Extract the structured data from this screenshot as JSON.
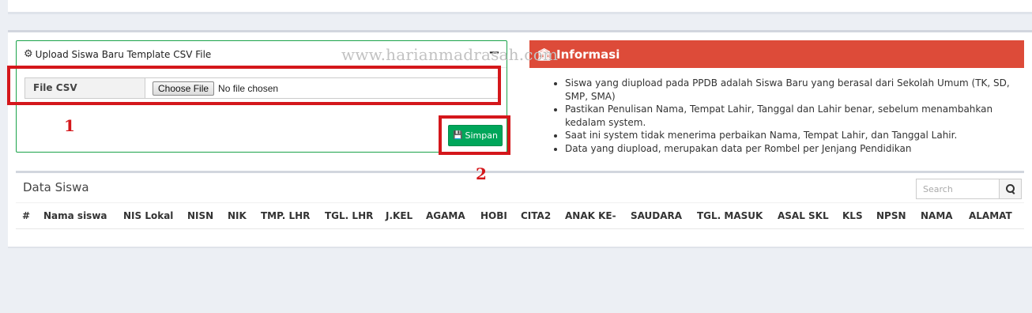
{
  "upload": {
    "title": "Upload Siswa Baru Template CSV File",
    "collapse_symbol": "−",
    "file_label": "File CSV",
    "choose_button": "Choose File",
    "file_status": "No file chosen",
    "save_button": "Simpan"
  },
  "watermark": "www.harianmadrasah.com",
  "annotations": {
    "box1_number": "1",
    "box2_number": "2"
  },
  "info": {
    "title": "Informasi",
    "items": [
      "Siswa yang diupload pada PPDB adalah Siswa Baru yang berasal dari Sekolah Umum (TK, SD, SMP, SMA)",
      "Pastikan Penulisan Nama, Tempat Lahir, Tanggal dan Lahir benar, sebelum menambahkan kedalam system.",
      "Saat ini system tidak menerima perbaikan Nama, Tempat Lahir, dan Tanggal Lahir.",
      "Data yang diupload, merupakan data per Rombel per Jenjang Pendidikan"
    ]
  },
  "data_siswa": {
    "title": "Data Siswa",
    "search_placeholder": "Search",
    "columns": [
      "#",
      "Nama siswa",
      "NIS Lokal",
      "NISN",
      "NIK",
      "TMP. LHR",
      "TGL. LHR",
      "J.KEL",
      "AGAMA",
      "HOBI",
      "CITA2",
      "ANAK KE-",
      "SAUDARA",
      "TGL. MASUK",
      "ASAL SKL",
      "KLS",
      "NPSN",
      "NAMA",
      "ALAMAT"
    ]
  },
  "colors": {
    "success": "#00a65a",
    "danger": "#dd4b39",
    "annotation": "#d4171b"
  }
}
